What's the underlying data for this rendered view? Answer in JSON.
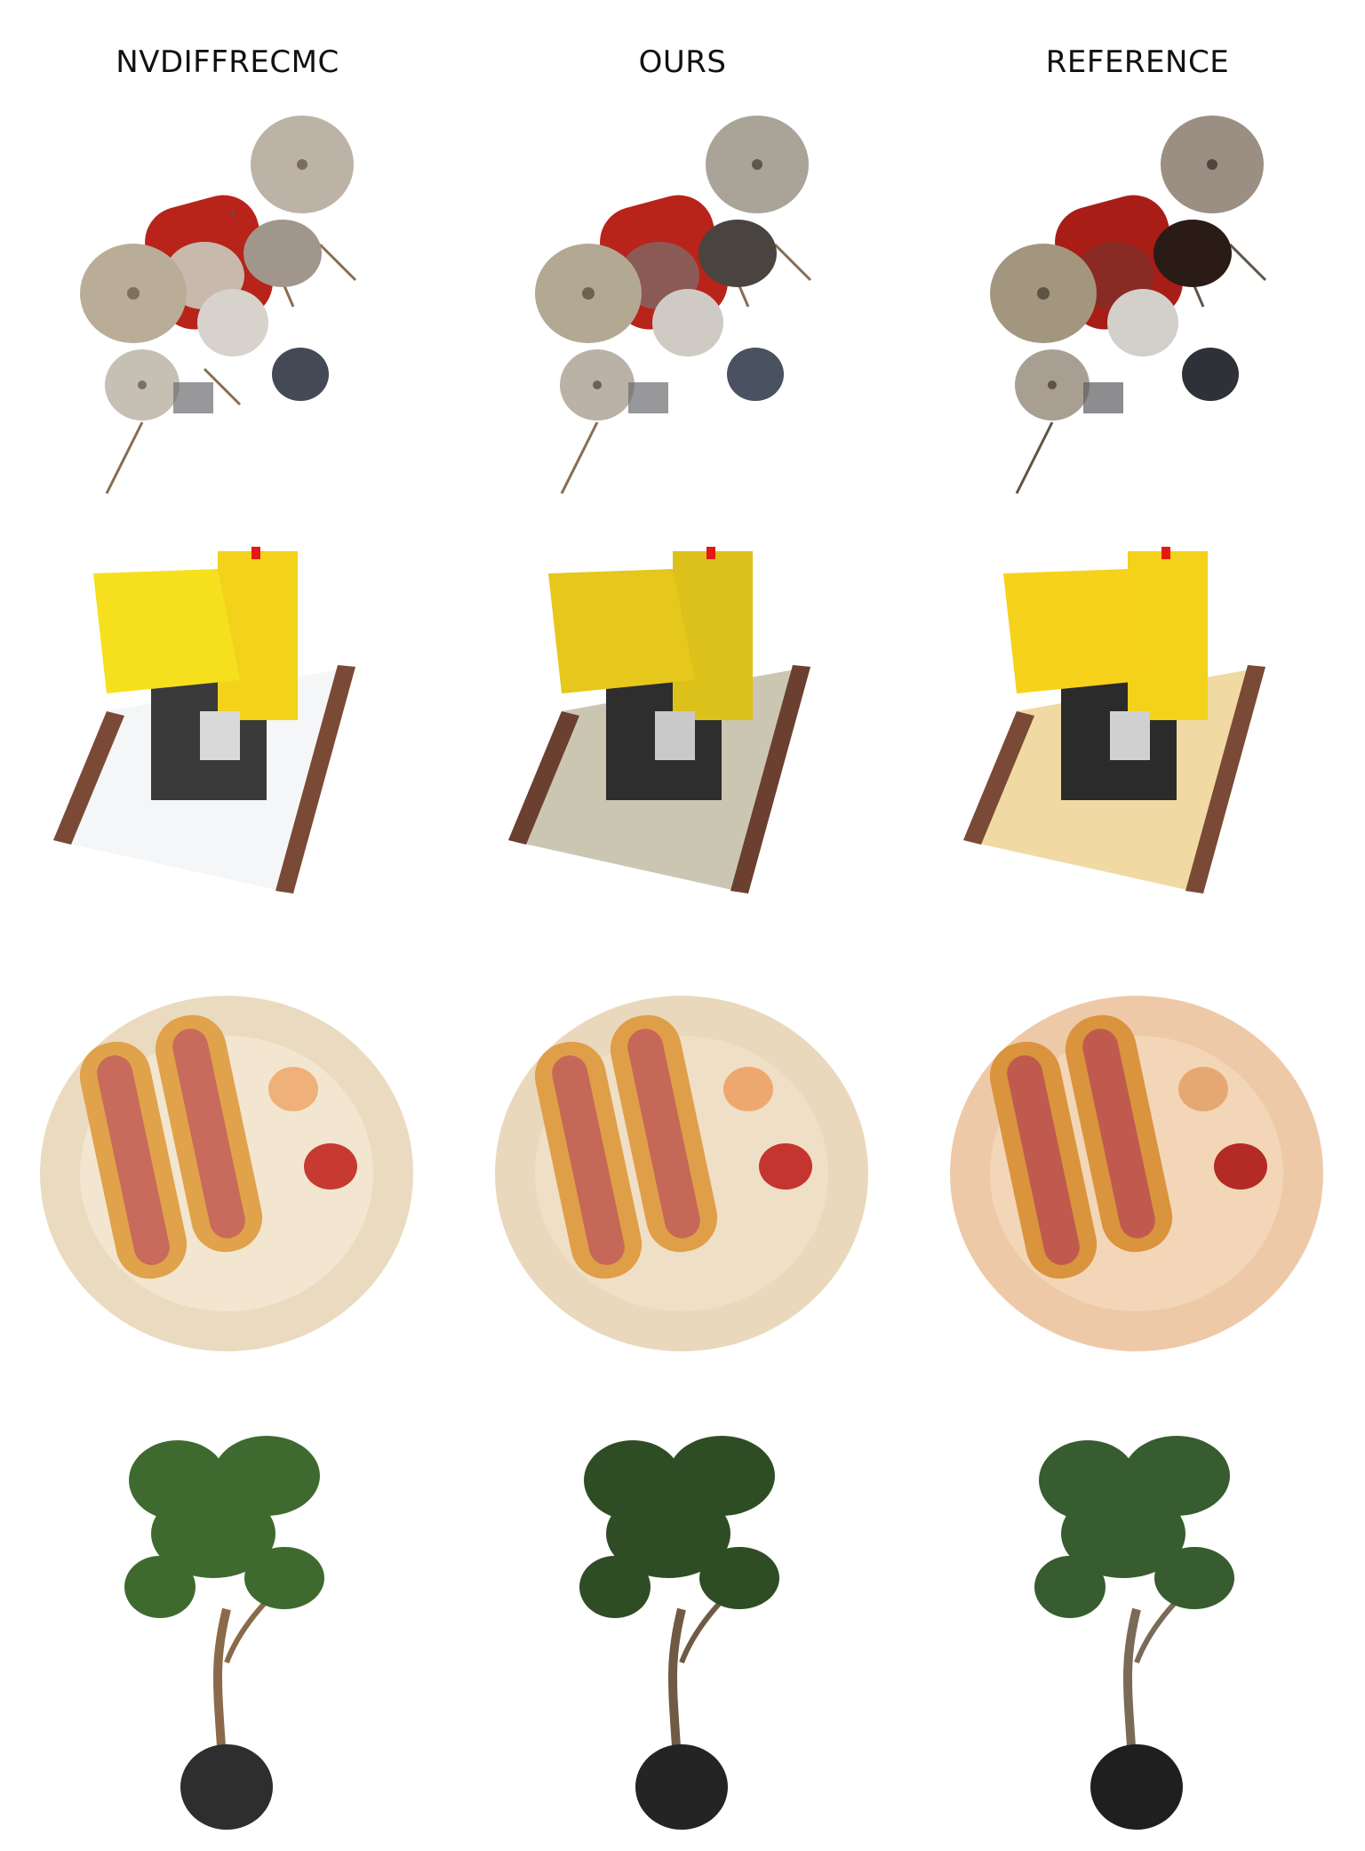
{
  "columns": [
    {
      "label": "NVDIFFRECMC"
    },
    {
      "label": "OURS"
    },
    {
      "label": "REFERENCE"
    }
  ],
  "rows": [
    {
      "scene": "drums-render"
    },
    {
      "scene": "lego-bulldozer-render"
    },
    {
      "scene": "hotdog-plate-render"
    },
    {
      "scene": "ficus-plant-render"
    }
  ],
  "palette": {
    "drum_red": "#b8231a",
    "cymbal": "#b9ad98",
    "lego_yellow": "#f2d21a",
    "plate": "#f0dcc2",
    "plant_green": "#3f6a2f",
    "pot": "#2e2e2e"
  }
}
